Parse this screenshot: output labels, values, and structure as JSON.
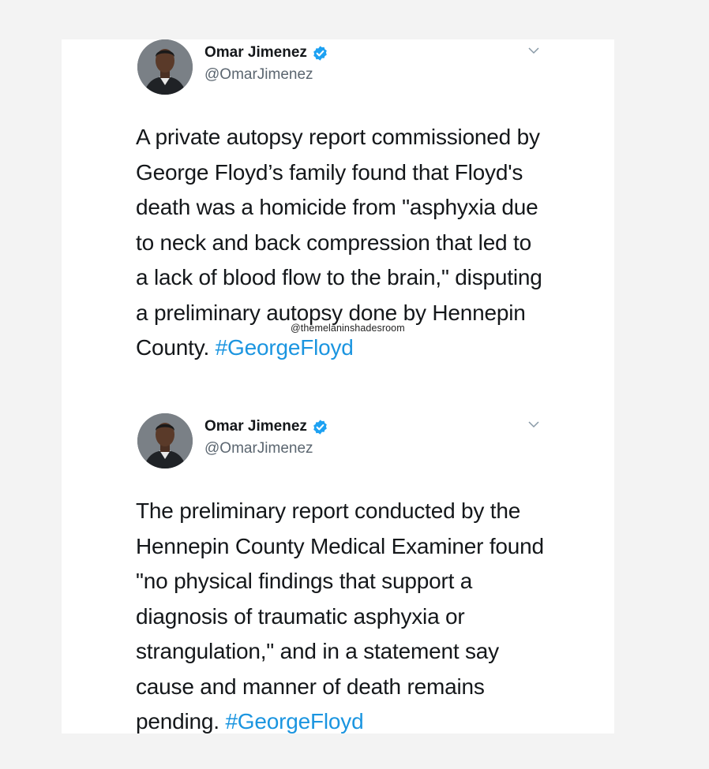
{
  "tweets": [
    {
      "author": {
        "name": "Omar Jimenez",
        "handle": "@OmarJimenez",
        "verified": true
      },
      "text": "A private autopsy report commissioned by George Floyd’s family found that Floyd's death was a homicide from \"asphyxia due to neck and back compression that led to a lack of blood flow to the brain,\" disputing a preliminary autopsy done by Hennepin County.",
      "hashtag": "#GeorgeFloyd"
    },
    {
      "author": {
        "name": "Omar Jimenez",
        "handle": "@OmarJimenez",
        "verified": true
      },
      "text": "The preliminary report conducted by the Hennepin County Medical Examiner found \"no physical findings that support a diagnosis of traumatic asphyxia or strangulation,\" and in a statement say cause and manner of death remains pending.",
      "hashtag": "#GeorgeFloyd"
    }
  ],
  "watermark": "@themelaninshadesroom",
  "colors": {
    "hashtag": "#1b95e0",
    "verified_badge": "#1da1f2",
    "text": "#14171a",
    "secondary_text": "#5b6670"
  },
  "icons": {
    "verified": "verified-badge-icon",
    "caret": "chevron-down-icon"
  }
}
